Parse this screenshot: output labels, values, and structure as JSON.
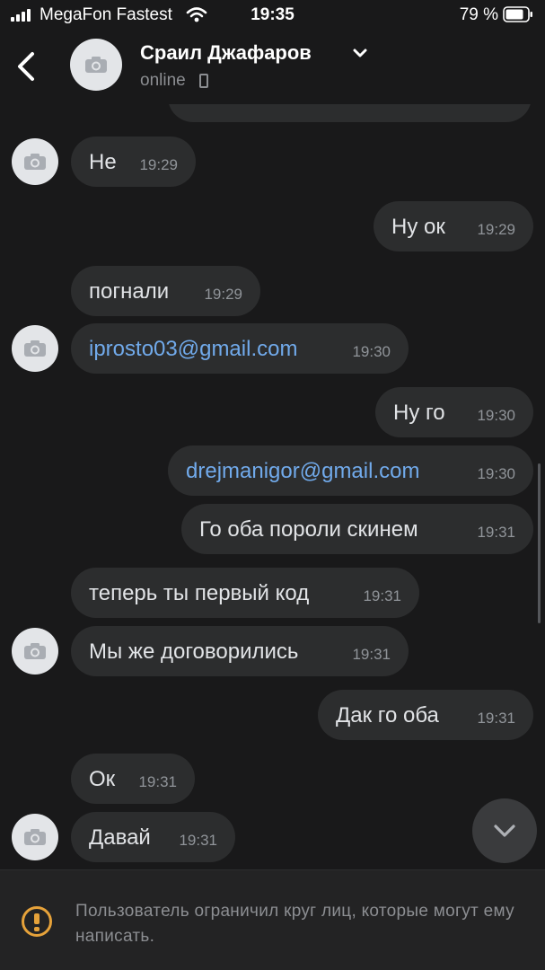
{
  "status_bar": {
    "carrier": "MegaFon Fastest",
    "time": "19:35",
    "battery": "79 %"
  },
  "header": {
    "name": "Сраил Джафаров",
    "status": "online"
  },
  "messages": [
    {
      "side": "in",
      "text": "Не",
      "time": "19:29"
    },
    {
      "side": "out",
      "text": "Ну ок",
      "time": "19:29"
    },
    {
      "side": "in",
      "text": "погнали",
      "time": "19:29"
    },
    {
      "side": "in",
      "text": "iprosto03@gmail.com",
      "time": "19:30"
    },
    {
      "side": "out",
      "text": "Ну го",
      "time": "19:30"
    },
    {
      "side": "out",
      "text": "drejmanigor@gmail.com",
      "time": "19:30"
    },
    {
      "side": "out",
      "text": "Го оба пороли скинем",
      "time": "19:31"
    },
    {
      "side": "in",
      "text": "теперь ты первый код",
      "time": "19:31"
    },
    {
      "side": "in",
      "text": "Мы же договорились",
      "time": "19:31"
    },
    {
      "side": "out",
      "text": "Дак го оба",
      "time": "19:31"
    },
    {
      "side": "in",
      "text": "Ок",
      "time": "19:31"
    },
    {
      "side": "in",
      "text": "Давай",
      "time": "19:31"
    }
  ],
  "footer": {
    "notice": "Пользователь ограничил круг лиц, которые могут ему написать."
  },
  "colors": {
    "background": "#19191a",
    "bubble": "#2c2d2e",
    "link": "#71aaeb",
    "warning": "#e6a23a"
  },
  "icons": [
    "back-icon",
    "camera-icon",
    "chevron-down-icon",
    "phone-icon",
    "wifi-icon",
    "battery-icon",
    "warning-icon"
  ]
}
